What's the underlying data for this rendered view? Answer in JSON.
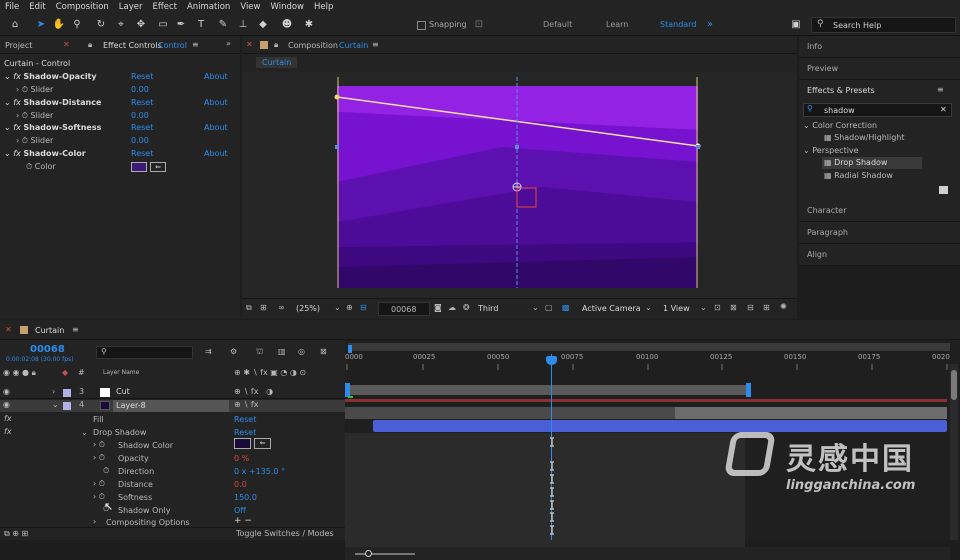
{
  "menu": [
    "File",
    "Edit",
    "Composition",
    "Layer",
    "Effect",
    "Animation",
    "View",
    "Window",
    "Help"
  ],
  "toolbar": {
    "snapping": "Snapping",
    "workspaces": [
      "Default",
      "Learn",
      "Standard"
    ],
    "active_workspace": "Standard",
    "search_help": "Search Help"
  },
  "left_panel": {
    "tab_project": "Project",
    "tab_effect_controls": "Effect Controls",
    "tab_effect_target": "Control",
    "title": "Curtain - Control",
    "effects": [
      {
        "name": "Shadow-Opacity",
        "reset": "Reset",
        "about": "About",
        "param": "Slider",
        "value": "0.00"
      },
      {
        "name": "Shadow-Distance",
        "reset": "Reset",
        "about": "About",
        "param": "Slider",
        "value": "0.00"
      },
      {
        "name": "Shadow-Softness",
        "reset": "Reset",
        "about": "About",
        "param": "Slider",
        "value": "0.00"
      },
      {
        "name": "Shadow-Color",
        "reset": "Reset",
        "about": "About",
        "param": "Color",
        "value": ""
      }
    ],
    "color_value": "#3c1a78"
  },
  "composition": {
    "tab_label": "Composition",
    "tab_name": "Curtain",
    "breadcrumb": "Curtain",
    "zoom": "(25%)",
    "timecode": "00068",
    "resolution": "Third",
    "camera": "Active Camera",
    "view": "1 View"
  },
  "right_panel": {
    "info": "Info",
    "preview": "Preview",
    "effects_presets": "Effects & Presets",
    "search_value": "shadow",
    "tree": [
      {
        "label": "Color Correction",
        "level": 0
      },
      {
        "label": "Shadow/Highlight",
        "level": 1
      },
      {
        "label": "Perspective",
        "level": 0
      },
      {
        "label": "Drop Shadow",
        "level": 1,
        "selected": true
      },
      {
        "label": "Radial Shadow",
        "level": 1
      }
    ],
    "character": "Character",
    "paragraph": "Paragraph",
    "align": "Align"
  },
  "timeline": {
    "tab": "Curtain",
    "timecode": "00068",
    "sub_timecode": "0:00:02:08 (30.00 fps)",
    "layer_name_header": "Layer Name",
    "ticks": [
      "0000",
      "00025",
      "00050",
      "00075",
      "00100",
      "00125",
      "00150",
      "00175",
      "0020"
    ],
    "layers": [
      {
        "num": "3",
        "name": "Cut",
        "color": "#ffffff"
      },
      {
        "num": "4",
        "name": "Layer-8",
        "color": "#1a0a3c"
      }
    ],
    "properties": [
      {
        "label": "Fill",
        "value": "Reset",
        "indent": 1
      },
      {
        "label": "Drop Shadow",
        "value": "Reset",
        "indent": 1
      },
      {
        "label": "Shadow Color",
        "value": "",
        "indent": 2
      },
      {
        "label": "Opacity",
        "value": "0 %",
        "indent": 2
      },
      {
        "label": "Direction",
        "value": "0 x +135.0 °",
        "indent": 2
      },
      {
        "label": "Distance",
        "value": "0.0",
        "indent": 2
      },
      {
        "label": "Softness",
        "value": "150.0",
        "indent": 2
      },
      {
        "label": "Shadow Only",
        "value": "Off",
        "indent": 2
      },
      {
        "label": "Compositing Options",
        "value": "+ −",
        "indent": 2
      }
    ],
    "toggle": "Toggle Switches / Modes"
  },
  "watermark": {
    "cn": "灵感中国",
    "url": "lingganchina.com"
  }
}
